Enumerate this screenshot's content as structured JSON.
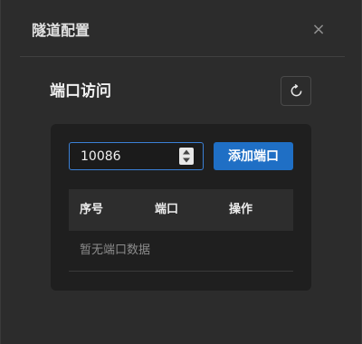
{
  "dialog": {
    "title": "隧道配置",
    "close_icon": "close-icon"
  },
  "section": {
    "title": "端口访问",
    "refresh_icon": "refresh-icon"
  },
  "port_input": {
    "value": "10086"
  },
  "add_button": {
    "label": "添加端口"
  },
  "table": {
    "columns": [
      "序号",
      "端口",
      "操作"
    ],
    "empty_text": "暂无端口数据"
  },
  "colors": {
    "primary": "#1f6fc5",
    "input_focus_border": "#3b80d6",
    "background": "#2c2c2c",
    "panel": "#1f1f1f"
  }
}
